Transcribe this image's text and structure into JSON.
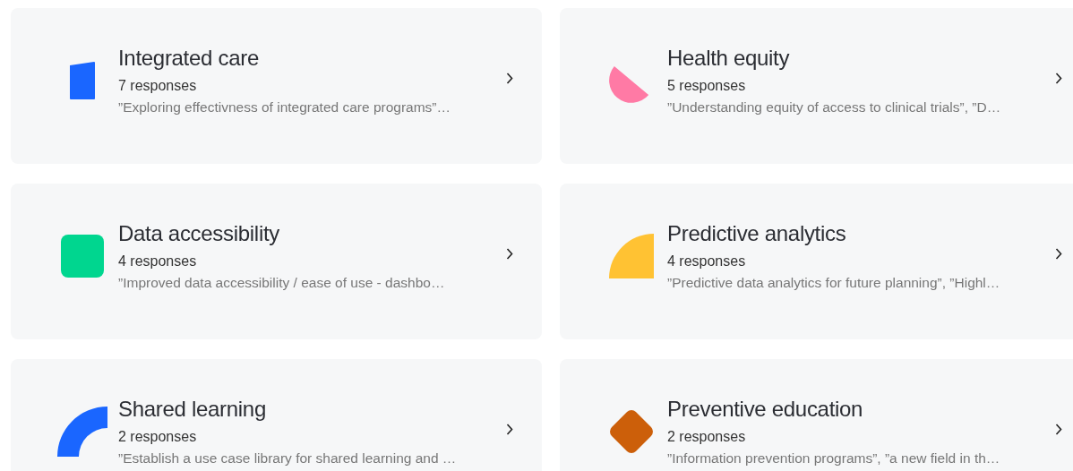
{
  "cards": [
    {
      "title": "Integrated care",
      "count": "7 responses",
      "excerpt": "”Exploring effectivness of integrated care programs”…",
      "kind": "bar",
      "color": "#1a66ff"
    },
    {
      "title": "Health equity",
      "count": "5 responses",
      "excerpt": "”Understanding equity of access to clinical trials”, ”D…",
      "kind": "half-circle",
      "color": "#ff7aa5"
    },
    {
      "title": "Data accessibility",
      "count": "4 responses",
      "excerpt": "”Improved data accessibility / ease of use - dashbo…",
      "kind": "rounded-square",
      "color": "#00d68f"
    },
    {
      "title": "Predictive analytics",
      "count": "4 responses",
      "excerpt": "”Predictive data analytics for future planning”, ”Highl…",
      "kind": "quarter-circle",
      "color": "#ffc233"
    },
    {
      "title": "Shared learning",
      "count": "2 responses",
      "excerpt": "”Establish a use case library for shared learning and …",
      "kind": "quarter-arc",
      "color": "#1a66ff"
    },
    {
      "title": "Preventive education",
      "count": "2 responses",
      "excerpt": "”Information prevention programs”, ”a new field in th…",
      "kind": "diamond",
      "color": "#cc5f0a"
    }
  ]
}
